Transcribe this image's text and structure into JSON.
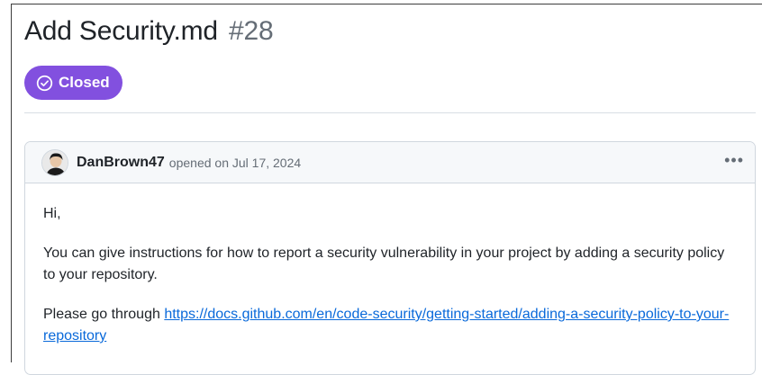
{
  "issue": {
    "title": "Add Security.md",
    "number": "#28",
    "state_label": "Closed",
    "state_color": "#8250df"
  },
  "comment": {
    "author": "DanBrown47",
    "meta": "opened on Jul 17, 2024",
    "menu_icon": "kebab-horizontal-icon",
    "greeting": "Hi,",
    "paragraph": "You can give instructions for how to report a security vulnerability in your project by adding a security policy to your repository.",
    "link_prefix": "Please go through",
    "link_text": "https://docs.github.com/en/code-security/getting-started/adding-a-security-policy-to-your-repository"
  },
  "colors": {
    "link": "#0969da",
    "muted": "#656d76",
    "border": "#d0d7de"
  }
}
